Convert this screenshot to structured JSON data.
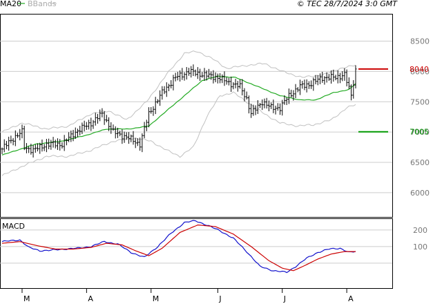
{
  "header": {
    "legend_ma": "MA20",
    "legend_bb": "BBands",
    "copyright": "© TEC 28/7/2024 3:0 GMT"
  },
  "macd_label": "MACD",
  "colors": {
    "ma": "#22aa22",
    "bands": "#c0c0c0",
    "price": "#000000",
    "resistance": "#cc0000",
    "support": "#009900",
    "macd": "#1111cc",
    "signal": "#cc0000",
    "grid": "#cccccc"
  },
  "chart_data": [
    {
      "type": "candlestick",
      "x": [
        "M",
        "A",
        "M",
        "J",
        "J",
        "A"
      ],
      "y_ticks": [
        8500,
        8000,
        7500,
        7000,
        6500,
        6000
      ],
      "ylim": [
        5600,
        8950
      ],
      "ylabel": "",
      "xlabel": "",
      "grid": true,
      "price_path": [
        {
          "i": 0,
          "v": 6720
        },
        {
          "i": 5,
          "v": 6900
        },
        {
          "i": 9,
          "v": 7000
        },
        {
          "i": 10,
          "v": 6750
        },
        {
          "i": 14,
          "v": 6700
        },
        {
          "i": 20,
          "v": 6800
        },
        {
          "i": 27,
          "v": 6800
        },
        {
          "i": 33,
          "v": 7000
        },
        {
          "i": 40,
          "v": 7150
        },
        {
          "i": 45,
          "v": 7300
        },
        {
          "i": 50,
          "v": 7000
        },
        {
          "i": 57,
          "v": 6900
        },
        {
          "i": 62,
          "v": 6800
        },
        {
          "i": 66,
          "v": 7300
        },
        {
          "i": 72,
          "v": 7650
        },
        {
          "i": 78,
          "v": 7900
        },
        {
          "i": 84,
          "v": 8000
        },
        {
          "i": 90,
          "v": 7950
        },
        {
          "i": 97,
          "v": 7900
        },
        {
          "i": 103,
          "v": 7800
        },
        {
          "i": 107,
          "v": 7750
        },
        {
          "i": 110,
          "v": 7550
        },
        {
          "i": 112,
          "v": 7300
        },
        {
          "i": 117,
          "v": 7500
        },
        {
          "i": 121,
          "v": 7400
        },
        {
          "i": 125,
          "v": 7400
        },
        {
          "i": 129,
          "v": 7600
        },
        {
          "i": 134,
          "v": 7750
        },
        {
          "i": 139,
          "v": 7800
        },
        {
          "i": 144,
          "v": 7900
        },
        {
          "i": 150,
          "v": 7900
        },
        {
          "i": 154,
          "v": 7950
        },
        {
          "i": 157,
          "v": 7600
        },
        {
          "i": 159,
          "v": 8040
        }
      ],
      "ma20": [
        {
          "i": 0,
          "v": 6620
        },
        {
          "i": 15,
          "v": 6800
        },
        {
          "i": 27,
          "v": 6850
        },
        {
          "i": 38,
          "v": 6950
        },
        {
          "i": 47,
          "v": 7050
        },
        {
          "i": 57,
          "v": 7050
        },
        {
          "i": 66,
          "v": 7100
        },
        {
          "i": 74,
          "v": 7350
        },
        {
          "i": 82,
          "v": 7600
        },
        {
          "i": 90,
          "v": 7850
        },
        {
          "i": 97,
          "v": 7920
        },
        {
          "i": 105,
          "v": 7900
        },
        {
          "i": 115,
          "v": 7750
        },
        {
          "i": 125,
          "v": 7600
        },
        {
          "i": 134,
          "v": 7530
        },
        {
          "i": 141,
          "v": 7530
        },
        {
          "i": 149,
          "v": 7650
        },
        {
          "i": 156,
          "v": 7700
        },
        {
          "i": 159,
          "v": 7800
        }
      ],
      "bband_upper": [
        {
          "i": 0,
          "v": 7000
        },
        {
          "i": 9,
          "v": 7150
        },
        {
          "i": 20,
          "v": 7050
        },
        {
          "i": 30,
          "v": 7100
        },
        {
          "i": 40,
          "v": 7300
        },
        {
          "i": 48,
          "v": 7350
        },
        {
          "i": 56,
          "v": 7200
        },
        {
          "i": 65,
          "v": 7500
        },
        {
          "i": 74,
          "v": 7950
        },
        {
          "i": 82,
          "v": 8300
        },
        {
          "i": 88,
          "v": 8330
        },
        {
          "i": 95,
          "v": 8200
        },
        {
          "i": 101,
          "v": 8050
        },
        {
          "i": 110,
          "v": 8100
        },
        {
          "i": 118,
          "v": 8130
        },
        {
          "i": 126,
          "v": 8000
        },
        {
          "i": 135,
          "v": 7900
        },
        {
          "i": 145,
          "v": 7950
        },
        {
          "i": 152,
          "v": 8050
        },
        {
          "i": 159,
          "v": 8100
        }
      ],
      "bband_lower": [
        {
          "i": 0,
          "v": 6280
        },
        {
          "i": 10,
          "v": 6450
        },
        {
          "i": 20,
          "v": 6600
        },
        {
          "i": 30,
          "v": 6600
        },
        {
          "i": 40,
          "v": 6700
        },
        {
          "i": 50,
          "v": 6850
        },
        {
          "i": 60,
          "v": 6900
        },
        {
          "i": 67,
          "v": 6850
        },
        {
          "i": 74,
          "v": 6700
        },
        {
          "i": 80,
          "v": 6600
        },
        {
          "i": 86,
          "v": 6750
        },
        {
          "i": 92,
          "v": 7250
        },
        {
          "i": 98,
          "v": 7600
        },
        {
          "i": 104,
          "v": 7650
        },
        {
          "i": 110,
          "v": 7500
        },
        {
          "i": 118,
          "v": 7300
        },
        {
          "i": 125,
          "v": 7150
        },
        {
          "i": 133,
          "v": 7100
        },
        {
          "i": 140,
          "v": 7120
        },
        {
          "i": 148,
          "v": 7200
        },
        {
          "i": 155,
          "v": 7400
        },
        {
          "i": 159,
          "v": 7450
        }
      ],
      "levels": [
        {
          "name": "resistance",
          "value": 8040,
          "label": "8040"
        },
        {
          "name": "support",
          "value": 7005,
          "label": "7005"
        }
      ]
    },
    {
      "type": "line",
      "title": "MACD",
      "y_ticks": [
        200,
        100
      ],
      "ylim": [
        -150,
        270
      ],
      "grid": true,
      "series": [
        {
          "key": "macd",
          "points": [
            {
              "i": 0,
              "v": 130
            },
            {
              "i": 4,
              "v": 135
            },
            {
              "i": 8,
              "v": 140
            },
            {
              "i": 12,
              "v": 95
            },
            {
              "i": 17,
              "v": 75
            },
            {
              "i": 22,
              "v": 78
            },
            {
              "i": 28,
              "v": 85
            },
            {
              "i": 34,
              "v": 90
            },
            {
              "i": 40,
              "v": 100
            },
            {
              "i": 46,
              "v": 130
            },
            {
              "i": 52,
              "v": 115
            },
            {
              "i": 58,
              "v": 65
            },
            {
              "i": 64,
              "v": 35
            },
            {
              "i": 70,
              "v": 100
            },
            {
              "i": 76,
              "v": 180
            },
            {
              "i": 82,
              "v": 245
            },
            {
              "i": 87,
              "v": 255
            },
            {
              "i": 92,
              "v": 230
            },
            {
              "i": 98,
              "v": 195
            },
            {
              "i": 104,
              "v": 150
            },
            {
              "i": 110,
              "v": 70
            },
            {
              "i": 116,
              "v": -20
            },
            {
              "i": 122,
              "v": -45
            },
            {
              "i": 128,
              "v": -55
            },
            {
              "i": 132,
              "v": -20
            },
            {
              "i": 137,
              "v": 30
            },
            {
              "i": 142,
              "v": 65
            },
            {
              "i": 147,
              "v": 85
            },
            {
              "i": 152,
              "v": 90
            },
            {
              "i": 156,
              "v": 65
            },
            {
              "i": 159,
              "v": 70
            }
          ]
        },
        {
          "key": "signal",
          "points": [
            {
              "i": 0,
              "v": 120
            },
            {
              "i": 8,
              "v": 130
            },
            {
              "i": 16,
              "v": 105
            },
            {
              "i": 24,
              "v": 85
            },
            {
              "i": 32,
              "v": 85
            },
            {
              "i": 40,
              "v": 95
            },
            {
              "i": 47,
              "v": 120
            },
            {
              "i": 54,
              "v": 110
            },
            {
              "i": 60,
              "v": 75
            },
            {
              "i": 66,
              "v": 45
            },
            {
              "i": 72,
              "v": 90
            },
            {
              "i": 80,
              "v": 185
            },
            {
              "i": 88,
              "v": 230
            },
            {
              "i": 96,
              "v": 220
            },
            {
              "i": 104,
              "v": 175
            },
            {
              "i": 112,
              "v": 100
            },
            {
              "i": 120,
              "v": 15
            },
            {
              "i": 126,
              "v": -30
            },
            {
              "i": 131,
              "v": -45
            },
            {
              "i": 136,
              "v": -15
            },
            {
              "i": 142,
              "v": 25
            },
            {
              "i": 148,
              "v": 55
            },
            {
              "i": 154,
              "v": 70
            },
            {
              "i": 159,
              "v": 70
            }
          ]
        }
      ]
    }
  ]
}
